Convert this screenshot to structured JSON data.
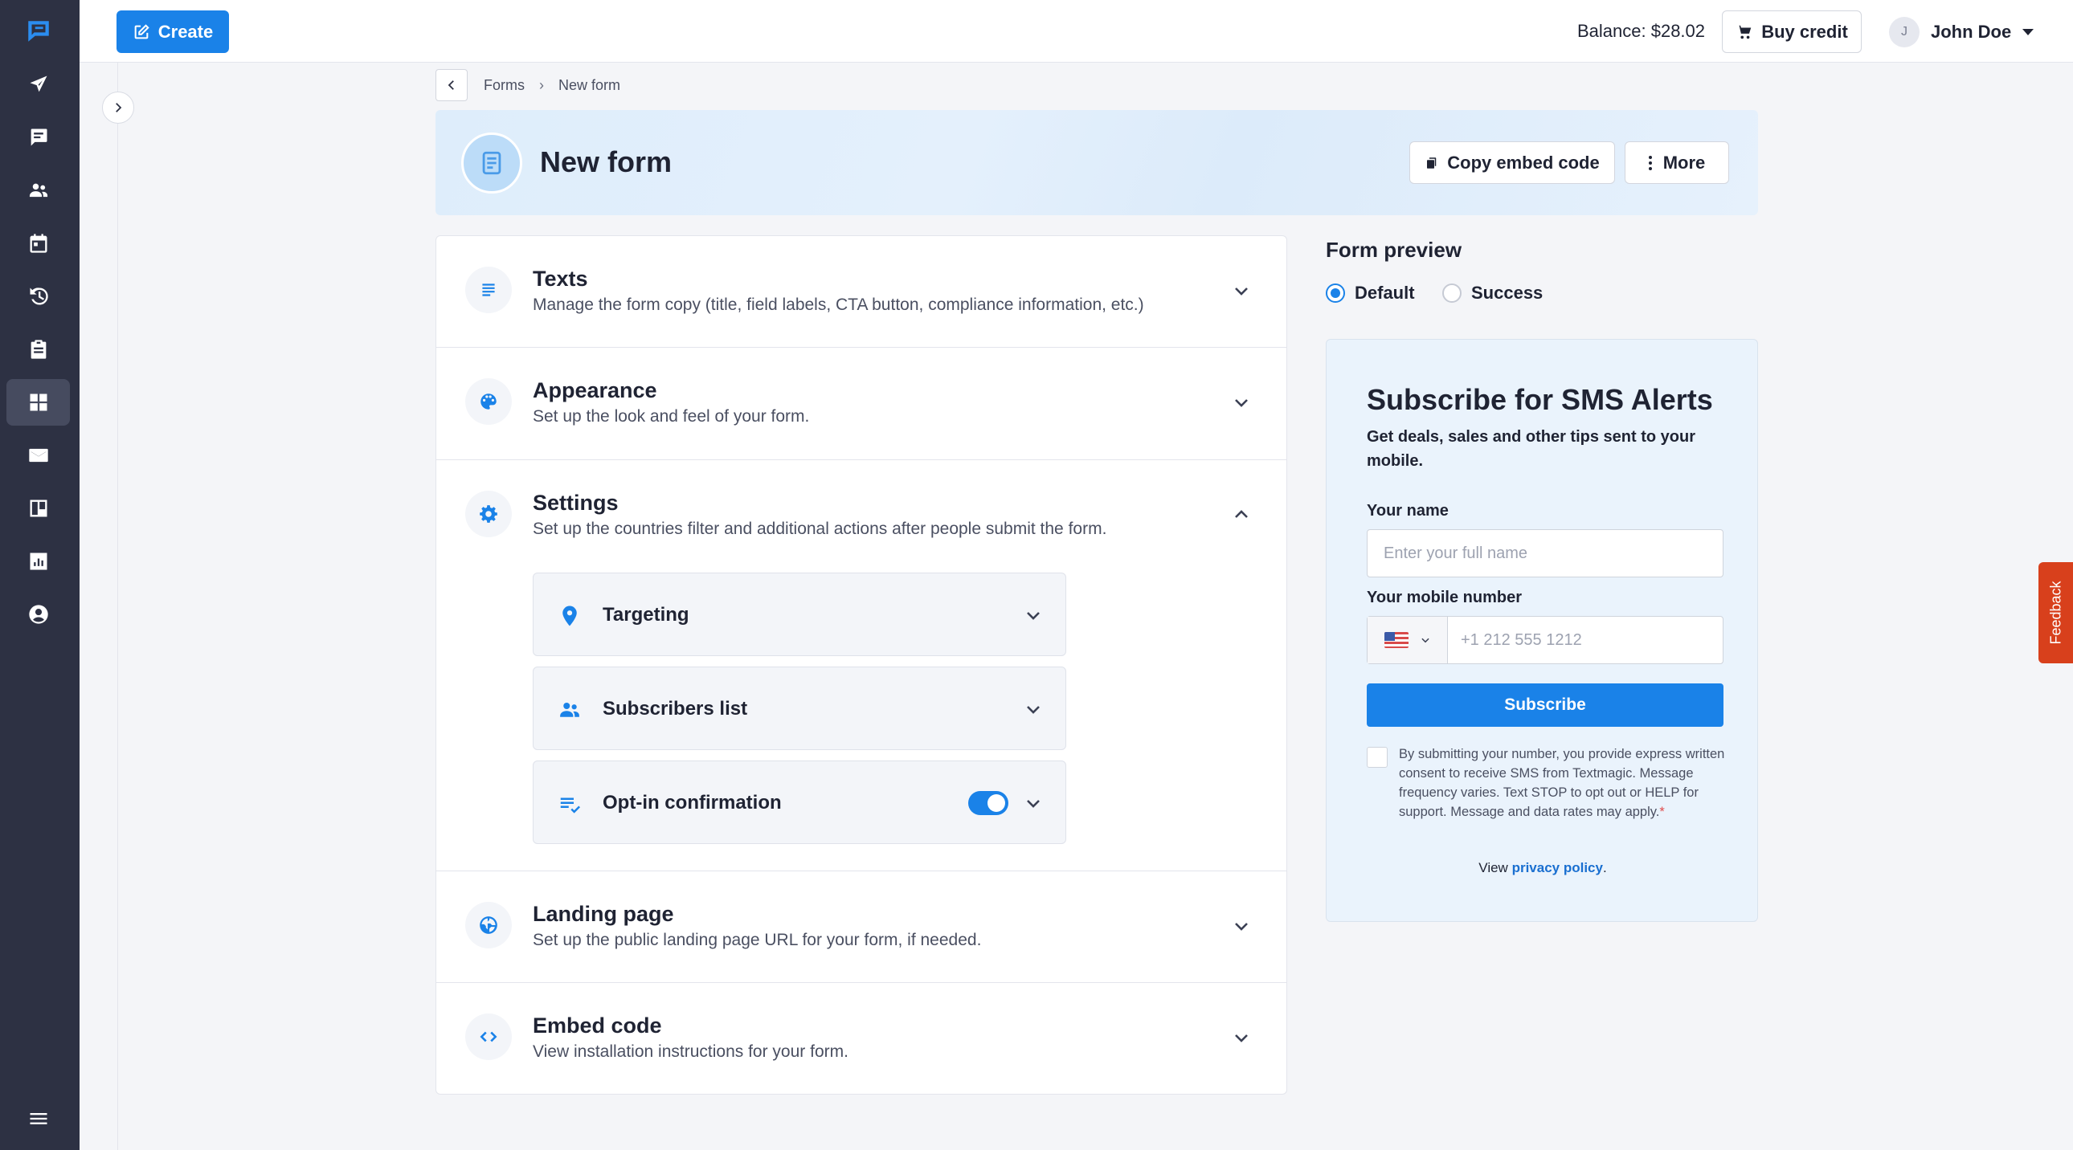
{
  "topbar": {
    "create_label": "Create",
    "balance": "Balance: $28.02",
    "buy_credit_label": "Buy credit",
    "user_initial": "J",
    "user_name": "John Doe"
  },
  "sidebar": {
    "items": [
      {
        "icon": "textmagic-logo-icon"
      },
      {
        "icon": "send-icon"
      },
      {
        "icon": "chat-icon"
      },
      {
        "icon": "contacts-icon"
      },
      {
        "icon": "calendar-icon"
      },
      {
        "icon": "history-icon"
      },
      {
        "icon": "clipboard-icon"
      },
      {
        "icon": "forms-icon",
        "active": true
      },
      {
        "icon": "mail-icon"
      },
      {
        "icon": "board-icon"
      },
      {
        "icon": "reports-icon"
      },
      {
        "icon": "account-icon"
      },
      {
        "icon": "menu-icon"
      }
    ]
  },
  "breadcrumb": {
    "items": [
      "Forms",
      "New form"
    ]
  },
  "header": {
    "title": "New form",
    "copy_embed_label": "Copy embed code",
    "more_label": "More"
  },
  "sections": [
    {
      "title": "Texts",
      "description": "Manage the form copy (title, field labels, CTA button, compliance information, etc.)",
      "icon": "text-lines-icon",
      "expanded": false
    },
    {
      "title": "Appearance",
      "description": "Set up the look and feel of your form.",
      "icon": "palette-icon",
      "expanded": false
    },
    {
      "title": "Settings",
      "description": "Set up the countries filter and additional actions after people submit the form.",
      "icon": "gear-icon",
      "expanded": true
    },
    {
      "title": "Landing page",
      "description": "Set up the public landing page URL for your form, if needed.",
      "icon": "globe-icon",
      "expanded": false
    },
    {
      "title": "Embed code",
      "description": "View installation instructions for your form.",
      "icon": "code-icon",
      "expanded": false
    }
  ],
  "settings_items": [
    {
      "label": "Targeting",
      "icon": "location-pin-icon"
    },
    {
      "label": "Subscribers list",
      "icon": "people-icon"
    },
    {
      "label": "Opt-in confirmation",
      "icon": "checklist-icon",
      "toggle_on": true
    }
  ],
  "preview": {
    "title": "Form preview",
    "options": [
      "Default",
      "Success"
    ],
    "selected": "Default",
    "form": {
      "heading": "Subscribe for SMS Alerts",
      "subheading": "Get deals, sales and other tips sent to your mobile.",
      "name_label": "Your name",
      "name_placeholder": "Enter your full name",
      "phone_label": "Your mobile number",
      "phone_placeholder": "+1 212 555 1212",
      "subscribe_label": "Subscribe",
      "consent_text": "By submitting your number, you provide express written consent to receive SMS from Textmagic. Message frequency varies. Text STOP to opt out or HELP for support. Message and data rates may apply.",
      "consent_required_mark": "*",
      "privacy_prefix": "View",
      "privacy_link": "privacy policy",
      "privacy_suffix": "."
    }
  },
  "feedback_label": "Feedback",
  "colors": {
    "accent": "#1a82e8",
    "sidebar": "#2d3143",
    "feedback": "#d8401c"
  }
}
